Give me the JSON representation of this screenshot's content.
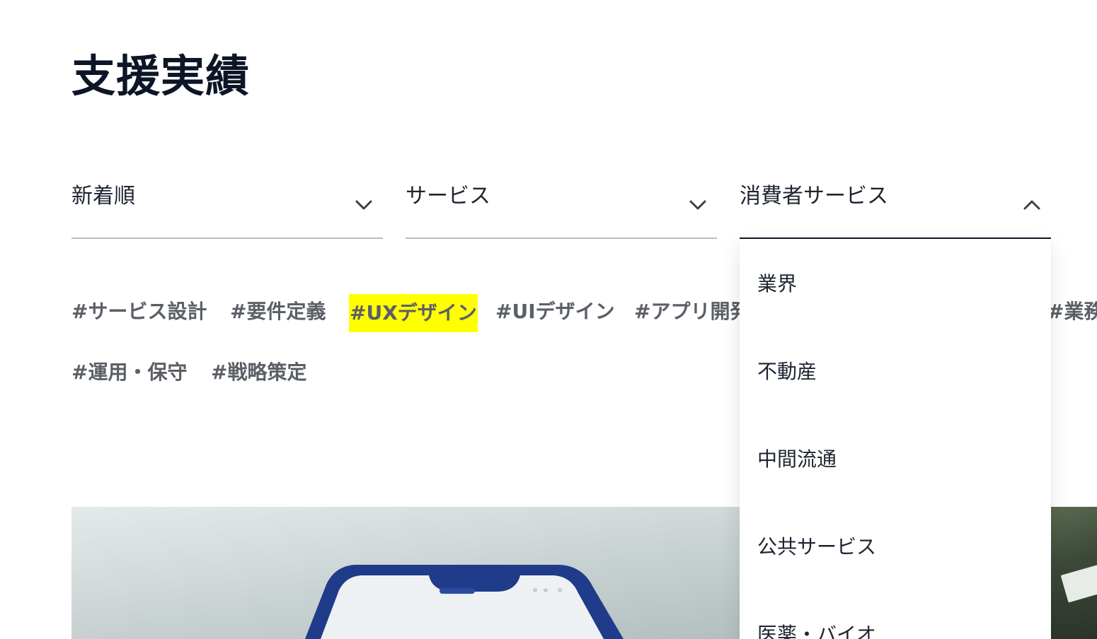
{
  "page": {
    "title": "支援実績"
  },
  "filters": {
    "sort": {
      "label": "新着順",
      "icon": "chevron-down-icon"
    },
    "category": {
      "label": "サービス",
      "icon": "chevron-down-icon"
    },
    "industry": {
      "label": "消費者サービス",
      "icon": "chevron-up-icon",
      "open": true
    }
  },
  "tags": [
    {
      "label": "#サービス設計",
      "active": false
    },
    {
      "label": "#要件定義",
      "active": false
    },
    {
      "label": "#UXデザイン",
      "active": true
    },
    {
      "label": "#UIデザイン",
      "active": false
    },
    {
      "label": "#アプリ開発",
      "active": false
    },
    {
      "label": "#業務",
      "active": false
    },
    {
      "label": "#運用・保守",
      "active": false
    },
    {
      "label": "#戦略策定",
      "active": false
    }
  ],
  "dropdown": {
    "items": [
      {
        "label": "業界"
      },
      {
        "label": "不動産"
      },
      {
        "label": "中間流通"
      },
      {
        "label": "公共サービス"
      },
      {
        "label": "医薬・バイオ"
      }
    ]
  },
  "colors": {
    "title": "#0d1626",
    "text": "#1d2430",
    "tag": "#5b5f66",
    "tag_active_bg": "#ffff00",
    "underline": "#b9bcc0",
    "underline_active": "#111827"
  },
  "images": {
    "main": "case-study-phone-photo",
    "side": "case-study-sign-photo"
  }
}
